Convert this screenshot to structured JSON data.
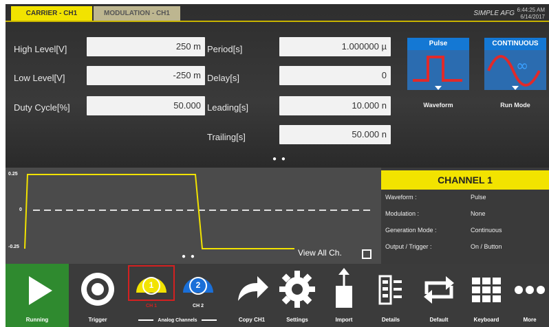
{
  "tabs": [
    {
      "label": "CARRIER - CH1"
    },
    {
      "label": "MODULATION - CH1"
    }
  ],
  "brand": "SIMPLE AFG",
  "clock": {
    "time": "6:44:25 AM",
    "date": "6/14/2017"
  },
  "params": {
    "high_level": {
      "label": "High Level[V]",
      "value": "250 m"
    },
    "low_level": {
      "label": "Low Level[V]",
      "value": "-250 m"
    },
    "duty_cycle": {
      "label": "Duty Cycle[%]",
      "value": "50.000"
    },
    "period": {
      "label": "Period[s]",
      "value": "1.000000 µ"
    },
    "delay": {
      "label": "Delay[s]",
      "value": "0"
    },
    "leading": {
      "label": "Leading[s]",
      "value": "10.000 n"
    },
    "trailing": {
      "label": "Trailing[s]",
      "value": "50.000 n"
    }
  },
  "waveform": {
    "header": "Pulse",
    "caption": "Waveform"
  },
  "run_mode": {
    "header": "CONTINUOUS",
    "caption": "Run Mode"
  },
  "page_dots": "● ●",
  "scope": {
    "y_top": "0.25",
    "y_mid": "0",
    "y_bottom": "-0.25",
    "view_all_label": "View All Ch.",
    "dots": "● ●"
  },
  "channel": {
    "title": "CHANNEL 1",
    "rows": [
      {
        "key": "Waveform :",
        "value": "Pulse"
      },
      {
        "key": "Modulation :",
        "value": "None"
      },
      {
        "key": "Generation Mode :",
        "value": "Continuous"
      },
      {
        "key": "Output / Trigger :",
        "value": "On / Button"
      }
    ]
  },
  "toolbar": {
    "running": "Running",
    "trigger": "Trigger",
    "ch1": {
      "number": "1",
      "caption": "CH 1"
    },
    "ch2": {
      "number": "2",
      "caption": "CH 2"
    },
    "analog": "Analog Channels",
    "copy": "Copy CH1",
    "settings": "Settings",
    "import": "Import",
    "details": "Details",
    "default": "Default",
    "keyboard": "Keyboard",
    "more": "More"
  },
  "colors": {
    "accent_yellow": "#f2e300",
    "tile_blue": "#1478d4",
    "run_green": "#2f8a2f",
    "ch1_yellow": "#f2e300",
    "ch2_blue": "#1a6fd8",
    "select_red": "#d42020"
  }
}
